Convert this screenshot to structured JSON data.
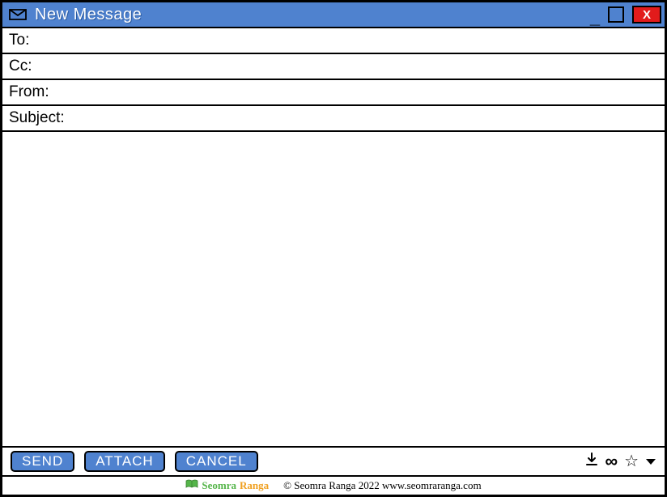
{
  "window": {
    "title": "New Message",
    "close_label": "X"
  },
  "fields": {
    "to_label": "To:",
    "cc_label": "Cc:",
    "from_label": "From:",
    "subject_label": "Subject:"
  },
  "toolbar": {
    "send_label": "SEND",
    "attach_label": "ATTACH",
    "cancel_label": "CANCEL"
  },
  "footer": {
    "brand1": "Seomra",
    "brand2": "Ranga",
    "copyright": "© Seomra Ranga 2022 www.seomraranga.com"
  }
}
